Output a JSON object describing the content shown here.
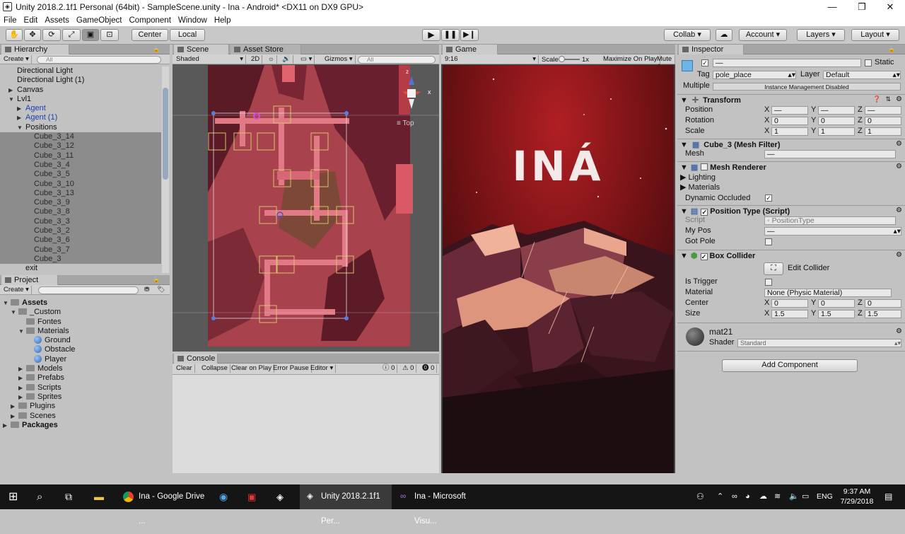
{
  "window": {
    "title": "Unity 2018.2.1f1 Personal (64bit) - SampleScene.unity - Ina - Android* <DX11 on DX9 GPU>"
  },
  "menu": [
    "File",
    "Edit",
    "Assets",
    "GameObject",
    "Component",
    "Window",
    "Help"
  ],
  "toolbar": {
    "center": "Center",
    "local": "Local",
    "collab": "Collab ▾",
    "account": "Account",
    "layers": "Layers",
    "layout": "Layout"
  },
  "hierarchy": {
    "tab": "Hierarchy",
    "create": "Create",
    "search": "All",
    "items": [
      {
        "label": "Directional Light",
        "indent": 0,
        "arrow": "",
        "sel": false,
        "blue": false
      },
      {
        "label": "Directional Light (1)",
        "indent": 0,
        "arrow": "",
        "sel": false,
        "blue": false
      },
      {
        "label": "Canvas",
        "indent": 0,
        "arrow": "▶",
        "sel": false,
        "blue": false
      },
      {
        "label": "Lvl1",
        "indent": 0,
        "arrow": "▼",
        "sel": false,
        "blue": false
      },
      {
        "label": "Agent",
        "indent": 1,
        "arrow": "▶",
        "sel": false,
        "blue": true
      },
      {
        "label": "Agent (1)",
        "indent": 1,
        "arrow": "▶",
        "sel": false,
        "blue": true
      },
      {
        "label": "Positions",
        "indent": 1,
        "arrow": "▼",
        "sel": false,
        "blue": false
      },
      {
        "label": "Cube_3_14",
        "indent": 2,
        "arrow": "",
        "sel": true,
        "blue": false
      },
      {
        "label": "Cube_3_12",
        "indent": 2,
        "arrow": "",
        "sel": true,
        "blue": false
      },
      {
        "label": "Cube_3_11",
        "indent": 2,
        "arrow": "",
        "sel": true,
        "blue": false
      },
      {
        "label": "Cube_3_4",
        "indent": 2,
        "arrow": "",
        "sel": true,
        "blue": false
      },
      {
        "label": "Cube_3_5",
        "indent": 2,
        "arrow": "",
        "sel": true,
        "blue": false
      },
      {
        "label": "Cube_3_10",
        "indent": 2,
        "arrow": "",
        "sel": true,
        "blue": false
      },
      {
        "label": "Cube_3_13",
        "indent": 2,
        "arrow": "",
        "sel": true,
        "blue": false
      },
      {
        "label": "Cube_3_9",
        "indent": 2,
        "arrow": "",
        "sel": true,
        "blue": false
      },
      {
        "label": "Cube_3_8",
        "indent": 2,
        "arrow": "",
        "sel": true,
        "blue": false
      },
      {
        "label": "Cube_3_3",
        "indent": 2,
        "arrow": "",
        "sel": true,
        "blue": false
      },
      {
        "label": "Cube_3_2",
        "indent": 2,
        "arrow": "",
        "sel": true,
        "blue": false
      },
      {
        "label": "Cube_3_6",
        "indent": 2,
        "arrow": "",
        "sel": true,
        "blue": false
      },
      {
        "label": "Cube_3_7",
        "indent": 2,
        "arrow": "",
        "sel": true,
        "blue": false
      },
      {
        "label": "Cube_3",
        "indent": 2,
        "arrow": "",
        "sel": true,
        "blue": false
      },
      {
        "label": "exit",
        "indent": 1,
        "arrow": "",
        "sel": false,
        "blue": false
      }
    ]
  },
  "project": {
    "tab": "Project",
    "create": "Create",
    "items": [
      {
        "label": "Assets",
        "indent": 0,
        "arrow": "▼",
        "bold": true,
        "kind": "folder"
      },
      {
        "label": "_Custom",
        "indent": 1,
        "arrow": "▼",
        "bold": false,
        "kind": "folder"
      },
      {
        "label": "Fontes",
        "indent": 2,
        "arrow": "",
        "bold": false,
        "kind": "folder"
      },
      {
        "label": "Materials",
        "indent": 2,
        "arrow": "▼",
        "bold": false,
        "kind": "folder"
      },
      {
        "label": "Ground",
        "indent": 3,
        "arrow": "",
        "bold": false,
        "kind": "mat"
      },
      {
        "label": "Obstacle",
        "indent": 3,
        "arrow": "",
        "bold": false,
        "kind": "mat"
      },
      {
        "label": "Player",
        "indent": 3,
        "arrow": "",
        "bold": false,
        "kind": "mat"
      },
      {
        "label": "Models",
        "indent": 2,
        "arrow": "▶",
        "bold": false,
        "kind": "folder"
      },
      {
        "label": "Prefabs",
        "indent": 2,
        "arrow": "▶",
        "bold": false,
        "kind": "folder"
      },
      {
        "label": "Scripts",
        "indent": 2,
        "arrow": "▶",
        "bold": false,
        "kind": "folder"
      },
      {
        "label": "Sprites",
        "indent": 2,
        "arrow": "▶",
        "bold": false,
        "kind": "folder"
      },
      {
        "label": "Plugins",
        "indent": 1,
        "arrow": "▶",
        "bold": false,
        "kind": "folder"
      },
      {
        "label": "Scenes",
        "indent": 1,
        "arrow": "▶",
        "bold": false,
        "kind": "folder"
      },
      {
        "label": "Packages",
        "indent": 0,
        "arrow": "▶",
        "bold": true,
        "kind": "folder"
      }
    ]
  },
  "scene": {
    "tab": "Scene",
    "asset_store": "Asset Store",
    "shaded": "Shaded",
    "mode2d": "2D",
    "gizmos": "Gizmos",
    "search": "All",
    "top_label": "≡ Top",
    "axis_y": "z",
    "axis_x": "x"
  },
  "game": {
    "tab": "Game",
    "aspect": "9:16",
    "scale_label": "Scale",
    "scale_value": "1x",
    "maximize": "Maximize On Play",
    "mute": "Mute A",
    "logo": "INÁ"
  },
  "console": {
    "tab": "Console",
    "clear": "Clear",
    "collapse": "Collapse",
    "clear_on_play": "Clear on Play",
    "error_pause": "Error Pause",
    "editor": "Editor",
    "c1": "0",
    "c2": "0",
    "c3": "0"
  },
  "inspector": {
    "tab": "Inspector",
    "static": "Static",
    "tag_label": "Tag",
    "tag": "pole_place",
    "layer_label": "Layer",
    "layer": "Default",
    "multiple": "Multiple",
    "instance_note": "Instance Management Disabled",
    "transform": {
      "title": "Transform",
      "position": "Position",
      "rotation": "Rotation",
      "scale": "Scale",
      "pos": [
        "—",
        "—",
        "—"
      ],
      "rot": [
        "0",
        "0",
        "0"
      ],
      "scl": [
        "1",
        "1",
        "1"
      ]
    },
    "mesh_filter": {
      "title": "Cube_3 (Mesh Filter)",
      "mesh_label": "Mesh",
      "mesh": "—"
    },
    "mesh_renderer": {
      "title": "Mesh Renderer",
      "lighting": "Lighting",
      "materials": "Materials",
      "dynamic": "Dynamic Occluded"
    },
    "position_type": {
      "title": "Position Type (Script)",
      "script_label": "Script",
      "script": "PositionType",
      "mypos_label": "My Pos",
      "mypos": "—",
      "gotpole": "Got Pole"
    },
    "box_collider": {
      "title": "Box Collider",
      "edit": "Edit Collider",
      "trigger": "Is Trigger",
      "material_label": "Material",
      "material": "None (Physic Material)",
      "center_label": "Center",
      "center": [
        "0",
        "0",
        "0"
      ],
      "size_label": "Size",
      "size": [
        "1.5",
        "1.5",
        "1.5"
      ]
    },
    "material": {
      "name": "mat21",
      "shader_label": "Shader",
      "shader": "Standard"
    },
    "add_component": "Add Component"
  },
  "taskbar": {
    "chrome": "Ina - Google Drive ...",
    "unity": "Unity 2018.2.1f1 Per...",
    "vs": "Ina - Microsoft Visu...",
    "lang": "ENG",
    "time": "9:37 AM",
    "date": "7/29/2018"
  }
}
